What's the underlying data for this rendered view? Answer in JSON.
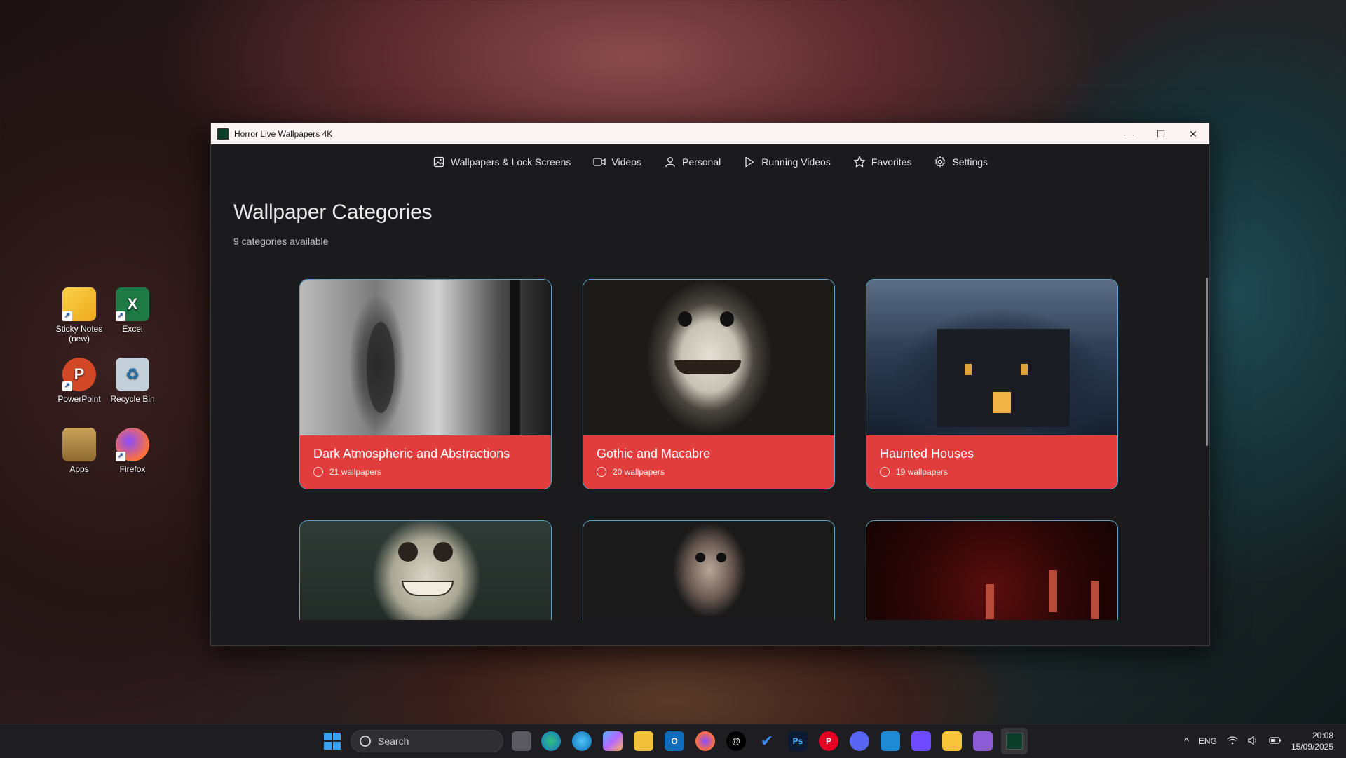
{
  "desktop": {
    "icons": [
      {
        "label": "Sticky Notes (new)",
        "icon": "sticky-notes-icon",
        "color": "#f6c330"
      },
      {
        "label": "Excel",
        "icon": "excel-icon",
        "color": "#1d7a45"
      },
      {
        "label": "PowerPoint",
        "icon": "powerpoint-icon",
        "color": "#d24726"
      },
      {
        "label": "Recycle Bin",
        "icon": "recycle-bin-icon",
        "color": "#cde7f5"
      },
      {
        "label": "Apps",
        "icon": "folder-icon",
        "color": "#b08a48"
      },
      {
        "label": "Firefox",
        "icon": "firefox-icon",
        "color": "#ff7139"
      }
    ]
  },
  "window": {
    "title": "Horror Live Wallpapers 4K",
    "controls": {
      "minimize": "—",
      "maximize": "☐",
      "close": "✕"
    }
  },
  "nav": [
    {
      "label": "Wallpapers & Lock Screens",
      "icon": "image-icon"
    },
    {
      "label": "Videos",
      "icon": "video-camera-icon"
    },
    {
      "label": "Personal",
      "icon": "person-icon"
    },
    {
      "label": "Running Videos",
      "icon": "play-icon"
    },
    {
      "label": "Favorites",
      "icon": "star-icon"
    },
    {
      "label": "Settings",
      "icon": "gear-icon"
    }
  ],
  "main": {
    "heading": "Wallpaper Categories",
    "subheading": "9 categories available"
  },
  "cards": [
    {
      "title": "Dark Atmospheric and Abstractions",
      "count": "21 wallpapers"
    },
    {
      "title": "Gothic and Macabre",
      "count": "20 wallpapers"
    },
    {
      "title": "Haunted Houses",
      "count": "19 wallpapers"
    },
    {
      "title": "",
      "count": ""
    },
    {
      "title": "",
      "count": ""
    },
    {
      "title": "",
      "count": ""
    }
  ],
  "accent": "#e23d3d",
  "taskbar": {
    "search_placeholder": "Search",
    "language": "ENG",
    "time": "20:08",
    "date": "15/09/2025",
    "apps": [
      "task-view-icon",
      "edge-icon",
      "edge-beta-icon",
      "copilot-icon",
      "file-explorer-icon",
      "outlook-icon",
      "firefox-icon",
      "threads-icon",
      "todo-icon",
      "photoshop-icon",
      "pinterest-icon",
      "discord-icon",
      "vscode-icon",
      "proton-icon",
      "sticky-notes-icon",
      "visual-studio-icon",
      "horror-wallpapers-icon"
    ]
  }
}
